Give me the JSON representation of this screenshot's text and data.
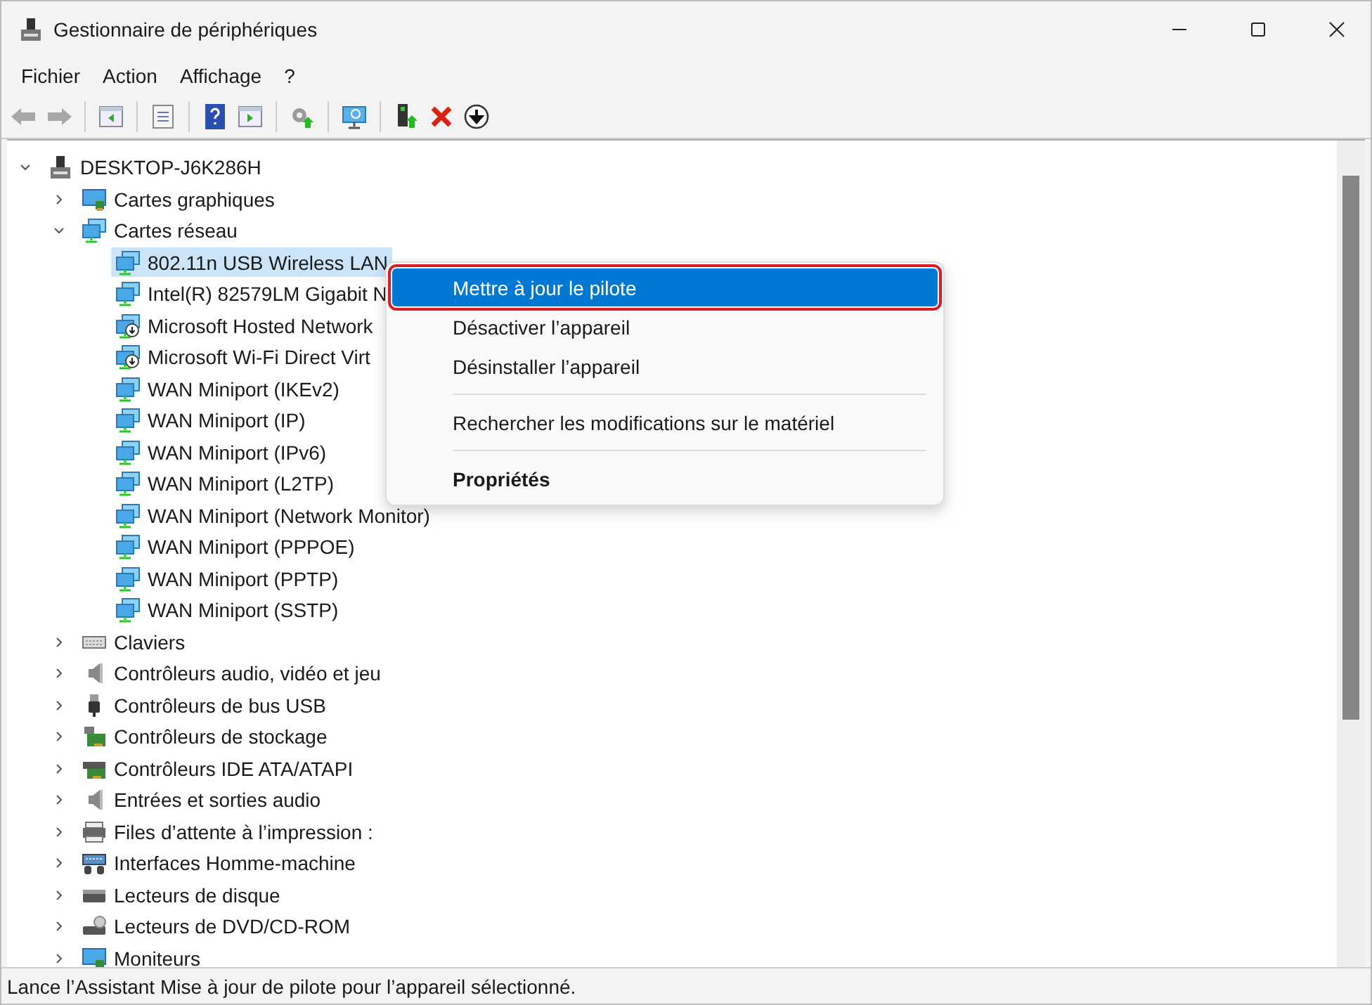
{
  "window": {
    "title": "Gestionnaire de périphériques"
  },
  "menu": [
    "Fichier",
    "Action",
    "Affichage",
    "?"
  ],
  "toolbar": [
    {
      "kind": "back",
      "disabled": true
    },
    {
      "kind": "forward",
      "disabled": true
    },
    {
      "kind": "separator"
    },
    {
      "kind": "pane-left",
      "disabled": false
    },
    {
      "kind": "separator"
    },
    {
      "kind": "properties",
      "disabled": false
    },
    {
      "kind": "separator"
    },
    {
      "kind": "help",
      "disabled": false
    },
    {
      "kind": "pane-right",
      "disabled": false
    },
    {
      "kind": "separator"
    },
    {
      "kind": "update-driver",
      "disabled": false
    },
    {
      "kind": "separator"
    },
    {
      "kind": "scan",
      "disabled": false
    },
    {
      "kind": "separator"
    },
    {
      "kind": "enable",
      "disabled": false
    },
    {
      "kind": "uninstall",
      "disabled": false
    },
    {
      "kind": "download",
      "disabled": false
    }
  ],
  "tree": [
    {
      "label": "DESKTOP-J6K286H",
      "kind": "computer",
      "expanded": true,
      "selected": false,
      "children": [
        {
          "label": "Cartes graphiques",
          "kind": "display",
          "expanded": false,
          "selected": false
        },
        {
          "label": "Cartes réseau",
          "kind": "network",
          "expanded": true,
          "selected": false,
          "children": [
            {
              "label": "802.11n USB Wireless LAN",
              "kind": "network",
              "selected": true
            },
            {
              "label": "Intel(R) 82579LM Gigabit N",
              "kind": "network",
              "selected": false
            },
            {
              "label": "Microsoft Hosted Network",
              "kind": "network-virtual",
              "selected": false
            },
            {
              "label": "Microsoft Wi-Fi Direct Virt",
              "kind": "network-virtual",
              "selected": false
            },
            {
              "label": "WAN Miniport (IKEv2)",
              "kind": "network",
              "selected": false
            },
            {
              "label": "WAN Miniport (IP)",
              "kind": "network",
              "selected": false
            },
            {
              "label": "WAN Miniport (IPv6)",
              "kind": "network",
              "selected": false
            },
            {
              "label": "WAN Miniport (L2TP)",
              "kind": "network",
              "selected": false
            },
            {
              "label": "WAN Miniport (Network Monitor)",
              "kind": "network",
              "selected": false
            },
            {
              "label": "WAN Miniport (PPPOE)",
              "kind": "network",
              "selected": false
            },
            {
              "label": "WAN Miniport (PPTP)",
              "kind": "network",
              "selected": false
            },
            {
              "label": "WAN Miniport (SSTP)",
              "kind": "network",
              "selected": false
            }
          ]
        },
        {
          "label": "Claviers",
          "kind": "keyboard",
          "expanded": false,
          "selected": false
        },
        {
          "label": "Contrôleurs audio, vidéo et jeu",
          "kind": "speaker",
          "expanded": false,
          "selected": false
        },
        {
          "label": "Contrôleurs de bus USB",
          "kind": "usb",
          "expanded": false,
          "selected": false
        },
        {
          "label": "Contrôleurs de stockage",
          "kind": "storage",
          "expanded": false,
          "selected": false
        },
        {
          "label": "Contrôleurs IDE ATA/ATAPI",
          "kind": "ide",
          "expanded": false,
          "selected": false
        },
        {
          "label": "Entrées et sorties audio",
          "kind": "speaker",
          "expanded": false,
          "selected": false
        },
        {
          "label": "Files d’attente à l’impression :",
          "kind": "printer",
          "expanded": false,
          "selected": false
        },
        {
          "label": "Interfaces Homme-machine",
          "kind": "hid",
          "expanded": false,
          "selected": false
        },
        {
          "label": "Lecteurs de disque",
          "kind": "disk",
          "expanded": false,
          "selected": false
        },
        {
          "label": "Lecteurs de DVD/CD-ROM",
          "kind": "dvd",
          "expanded": false,
          "selected": false
        },
        {
          "label": "Moniteurs",
          "kind": "display",
          "expanded": false,
          "selected": false
        }
      ]
    }
  ],
  "context_menu": [
    {
      "kind": "item",
      "label": "Mettre à jour le pilote",
      "selected": true,
      "outlined": true
    },
    {
      "kind": "item",
      "label": "Désactiver l’appareil",
      "selected": false,
      "outlined": false
    },
    {
      "kind": "item",
      "label": "Désinstaller l’appareil",
      "selected": false,
      "outlined": false
    },
    {
      "kind": "separator"
    },
    {
      "kind": "item",
      "label": "Rechercher les modifications sur le matériel",
      "selected": false,
      "outlined": false
    },
    {
      "kind": "separator"
    },
    {
      "kind": "default",
      "label": "Propriétés",
      "selected": false,
      "outlined": false
    }
  ],
  "status_bar": "Lance l’Assistant Mise à jour de pilote pour l’appareil sélectionné."
}
